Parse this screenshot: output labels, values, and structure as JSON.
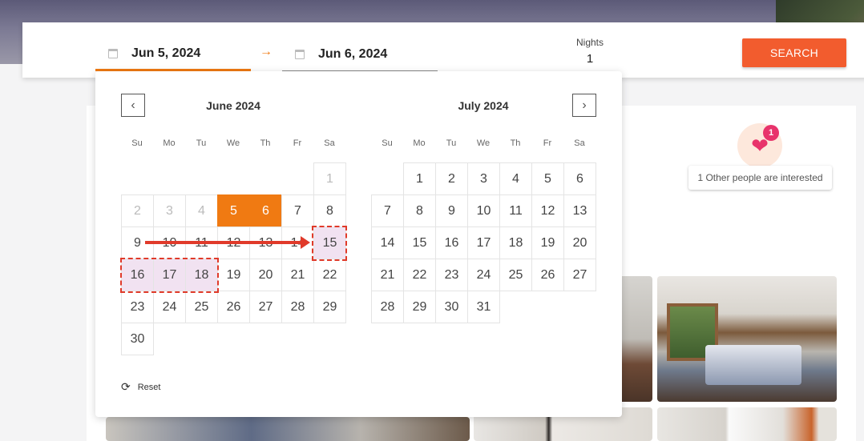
{
  "search": {
    "start_date": "Jun 5, 2024",
    "end_date": "Jun 6, 2024",
    "arrow_icon": "arrow-right-icon",
    "nights_label": "Nights",
    "nights_value": "1",
    "search_label": "SEARCH"
  },
  "interest": {
    "count": "1",
    "text": "1 Other people are interested"
  },
  "calendar": {
    "weekdays": [
      "Su",
      "Mo",
      "Tu",
      "We",
      "Th",
      "Fr",
      "Sa"
    ],
    "months": [
      {
        "title": "June 2024",
        "days": [
          "1",
          "2",
          "3",
          "4",
          "5",
          "6",
          "7",
          "8",
          "9",
          "10",
          "11",
          "12",
          "13",
          "14",
          "15",
          "16",
          "17",
          "18",
          "19",
          "20",
          "21",
          "22",
          "23",
          "24",
          "25",
          "26",
          "27",
          "28",
          "29",
          "30"
        ]
      },
      {
        "title": "July 2024",
        "days": [
          "1",
          "2",
          "3",
          "4",
          "5",
          "6",
          "7",
          "8",
          "9",
          "10",
          "11",
          "12",
          "13",
          "14",
          "15",
          "16",
          "17",
          "18",
          "19",
          "20",
          "21",
          "22",
          "23",
          "24",
          "25",
          "26",
          "27",
          "28",
          "29",
          "30",
          "31"
        ]
      }
    ],
    "reset_label": "Reset"
  },
  "colors": {
    "accent": "#f07a12",
    "search_button": "#f25c2e",
    "highlight": "#e03a2a",
    "heart": "#e8336b"
  }
}
